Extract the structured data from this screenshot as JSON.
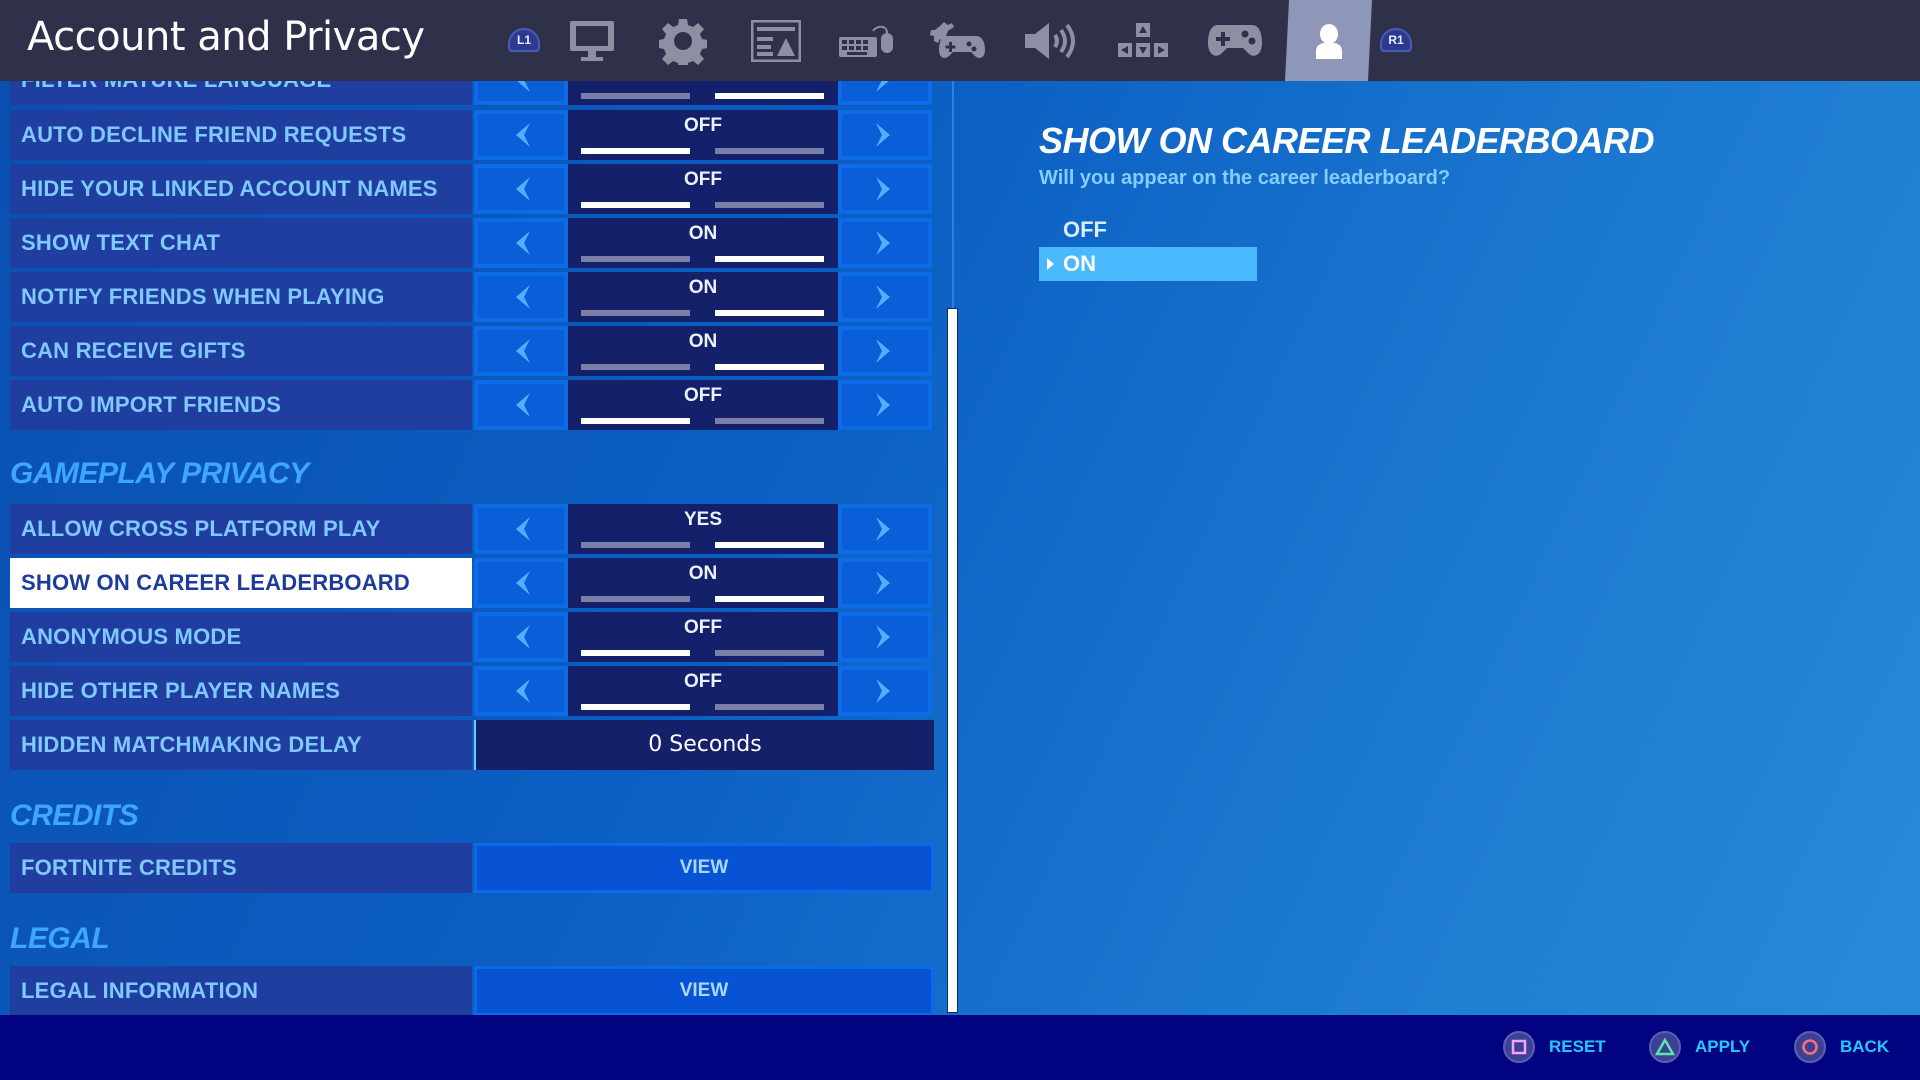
{
  "header": {
    "title": "Account and Privacy",
    "left_bumper": "L1",
    "right_bumper": "R1",
    "tabs": [
      {
        "name": "display",
        "icon": "monitor-icon"
      },
      {
        "name": "game",
        "icon": "gear-icon"
      },
      {
        "name": "brightness",
        "icon": "picture-icon"
      },
      {
        "name": "keyboard-mouse",
        "icon": "keyboard-mouse-icon"
      },
      {
        "name": "controller-options",
        "icon": "controller-gear-icon"
      },
      {
        "name": "audio",
        "icon": "speaker-icon"
      },
      {
        "name": "input-bindings",
        "icon": "arrow-keys-icon"
      },
      {
        "name": "controller",
        "icon": "gamepad-icon"
      },
      {
        "name": "account-privacy",
        "icon": "user-icon",
        "active": true
      }
    ]
  },
  "settings": {
    "rows_top": [
      {
        "label": "FILTER MATURE LANGUAGE",
        "value": "ON",
        "index": 1
      },
      {
        "label": "AUTO DECLINE FRIEND REQUESTS",
        "value": "OFF",
        "index": 0
      },
      {
        "label": "HIDE YOUR LINKED ACCOUNT NAMES",
        "value": "OFF",
        "index": 0
      },
      {
        "label": "SHOW TEXT CHAT",
        "value": "ON",
        "index": 1
      },
      {
        "label": "NOTIFY FRIENDS WHEN PLAYING",
        "value": "ON",
        "index": 1
      },
      {
        "label": "CAN RECEIVE GIFTS",
        "value": "ON",
        "index": 1
      },
      {
        "label": "AUTO IMPORT FRIENDS",
        "value": "OFF",
        "index": 0
      }
    ],
    "gameplay_section": "GAMEPLAY PRIVACY",
    "rows_gameplay": [
      {
        "label": "ALLOW CROSS PLATFORM PLAY",
        "value": "YES",
        "index": 1
      },
      {
        "label": "SHOW ON CAREER LEADERBOARD",
        "value": "ON",
        "index": 1,
        "selected": true
      },
      {
        "label": "ANONYMOUS MODE",
        "value": "OFF",
        "index": 0
      },
      {
        "label": "HIDE OTHER PLAYER NAMES",
        "value": "OFF",
        "index": 0
      }
    ],
    "matchmaking_delay": {
      "label": "HIDDEN MATCHMAKING DELAY",
      "value": "0 Seconds"
    },
    "credits_section": "CREDITS",
    "credits_row": {
      "label": "FORTNITE CREDITS",
      "button": "VIEW"
    },
    "legal_section": "LEGAL",
    "legal_row": {
      "label": "LEGAL INFORMATION",
      "button": "VIEW"
    }
  },
  "detail": {
    "title": "SHOW ON CAREER LEADERBOARD",
    "subtitle": "Will you appear on the career leaderboard?",
    "options": [
      "OFF",
      "ON"
    ],
    "selected_option": "ON"
  },
  "footer": {
    "reset": "RESET",
    "apply": "APPLY",
    "back": "BACK"
  },
  "colors": {
    "accent": "#4ab8ff",
    "topbar": "#2e3149",
    "footer": "#020380",
    "square": "#f2a4ff",
    "triangle": "#5fe3b0",
    "circle": "#ff6f7a"
  }
}
